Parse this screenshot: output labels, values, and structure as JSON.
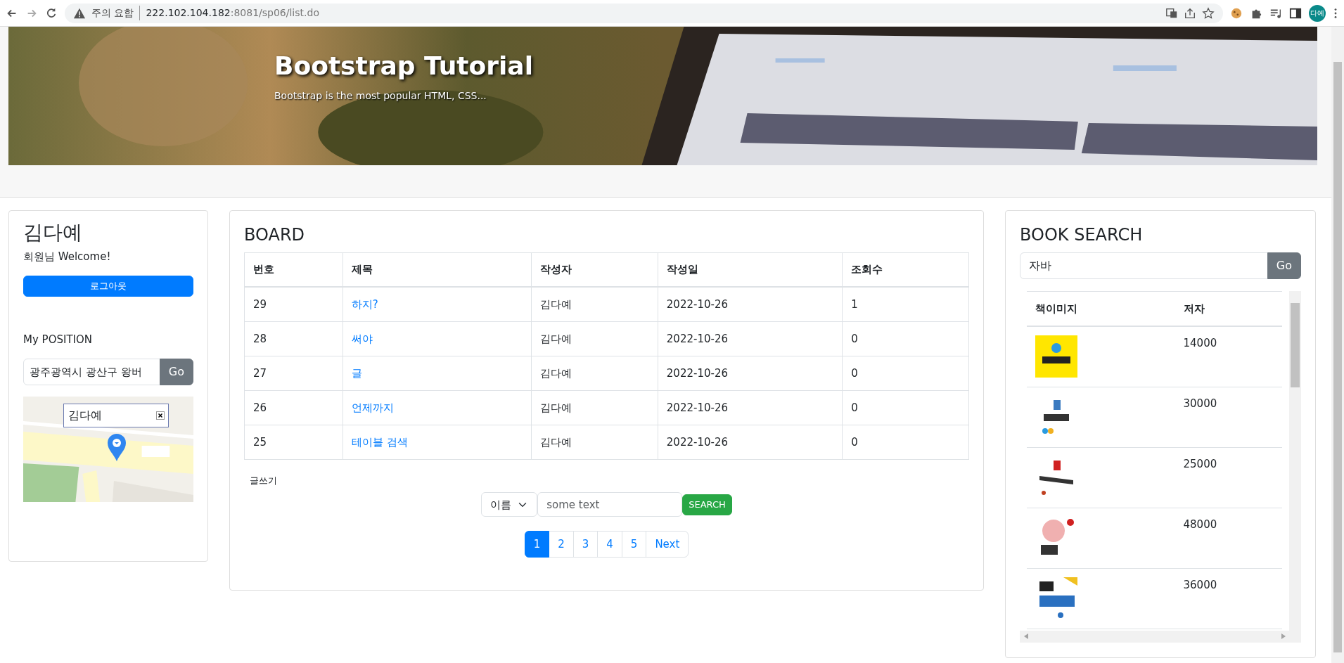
{
  "browser": {
    "security_label": "주의 요함",
    "url_host": "222.102.104.182",
    "url_rest": ":8081/sp06/list.do",
    "profile": "다예"
  },
  "banner": {
    "title": "Bootstrap Tutorial",
    "subtitle": "Bootstrap is the most popular HTML, CSS..."
  },
  "user_panel": {
    "name": "김다예",
    "greeting": "회원님 Welcome!",
    "logout_button": "로그아웃",
    "position_label": "My POSITION",
    "address_value": "광주광역시 광산구 왕버",
    "go_button": "Go",
    "map": {
      "kind": "picture",
      "info_window": "김다예"
    }
  },
  "board": {
    "title": "BOARD",
    "columns": [
      "번호",
      "제목",
      "작성자",
      "작성일",
      "조회수"
    ],
    "rows": [
      {
        "cells": [
          "29",
          "하지?",
          "김다예",
          "2022-10-26",
          "1"
        ]
      },
      {
        "cells": [
          "28",
          "써야",
          "김다예",
          "2022-10-26",
          "0"
        ]
      },
      {
        "cells": [
          "27",
          "글",
          "김다예",
          "2022-10-26",
          "0"
        ]
      },
      {
        "cells": [
          "26",
          "언제까지",
          "김다예",
          "2022-10-26",
          "0"
        ]
      },
      {
        "cells": [
          "25",
          "테이블 검색",
          "김다예",
          "2022-10-26",
          "0"
        ]
      }
    ],
    "write_link": "글쓰기",
    "search": {
      "select": "이름",
      "placeholder": "some text",
      "button": "SEARCH"
    },
    "pagination": [
      {
        "label": "1",
        "selected": true
      },
      {
        "label": "2",
        "selected": false
      },
      {
        "label": "3",
        "selected": false
      },
      {
        "label": "4",
        "selected": false
      },
      {
        "label": "5",
        "selected": false
      },
      {
        "label": "Next",
        "selected": false
      }
    ]
  },
  "book_search": {
    "title": "BOOK SEARCH",
    "query": "자바",
    "go_button": "Go",
    "columns": [
      "책이미지",
      "저자"
    ],
    "rows": [
      {
        "price": "14000"
      },
      {
        "price": "30000"
      },
      {
        "price": "25000"
      },
      {
        "price": "48000"
      },
      {
        "price": "36000"
      }
    ]
  }
}
